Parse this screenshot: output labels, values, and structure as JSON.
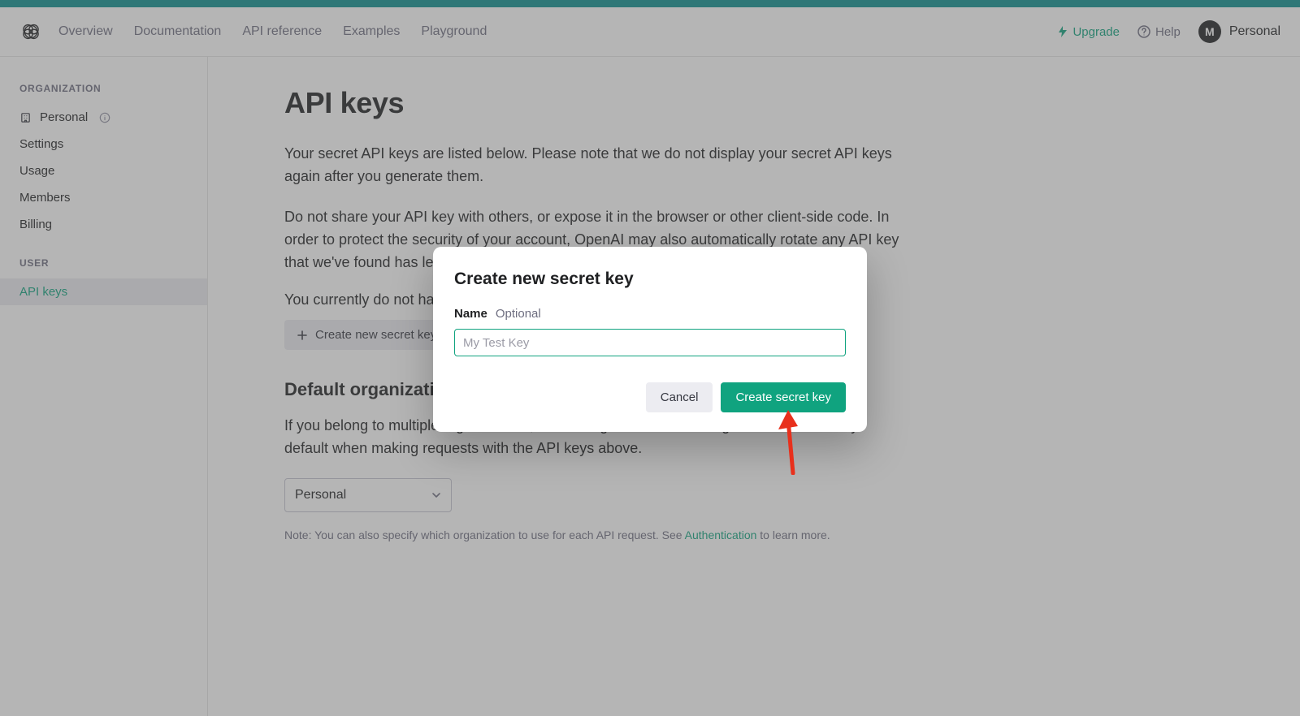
{
  "header": {
    "nav": [
      "Overview",
      "Documentation",
      "API reference",
      "Examples",
      "Playground"
    ],
    "upgrade": "Upgrade",
    "help": "Help",
    "account_initial": "M",
    "account_name": "Personal"
  },
  "sidebar": {
    "org_label": "ORGANIZATION",
    "org_name": "Personal",
    "org_items": [
      "Settings",
      "Usage",
      "Members",
      "Billing"
    ],
    "user_label": "USER",
    "user_items": [
      "API keys"
    ],
    "active": "API keys"
  },
  "page": {
    "title": "API keys",
    "p1": "Your secret API keys are listed below. Please note that we do not display your secret API keys again after you generate them.",
    "p2": "Do not share your API key with others, or expose it in the browser or other client-side code. In order to protect the security of your account, OpenAI may also automatically rotate any API key that we've found has leaked publicly.",
    "no_keys": "You currently do not have any API keys. Please create one below.",
    "create_btn": "Create new secret key",
    "default_org_heading": "Default organization",
    "default_org_p": "If you belong to multiple organizations, this setting controls which organization is used by default when making requests with the API keys above.",
    "select_value": "Personal",
    "note_pre": "Note: You can also specify which organization to use for each API request. See ",
    "note_link": "Authentication",
    "note_post": " to learn more."
  },
  "modal": {
    "title": "Create new secret key",
    "field_label": "Name",
    "field_hint": "Optional",
    "placeholder": "My Test Key",
    "input_value": "",
    "cancel": "Cancel",
    "submit": "Create secret key"
  }
}
